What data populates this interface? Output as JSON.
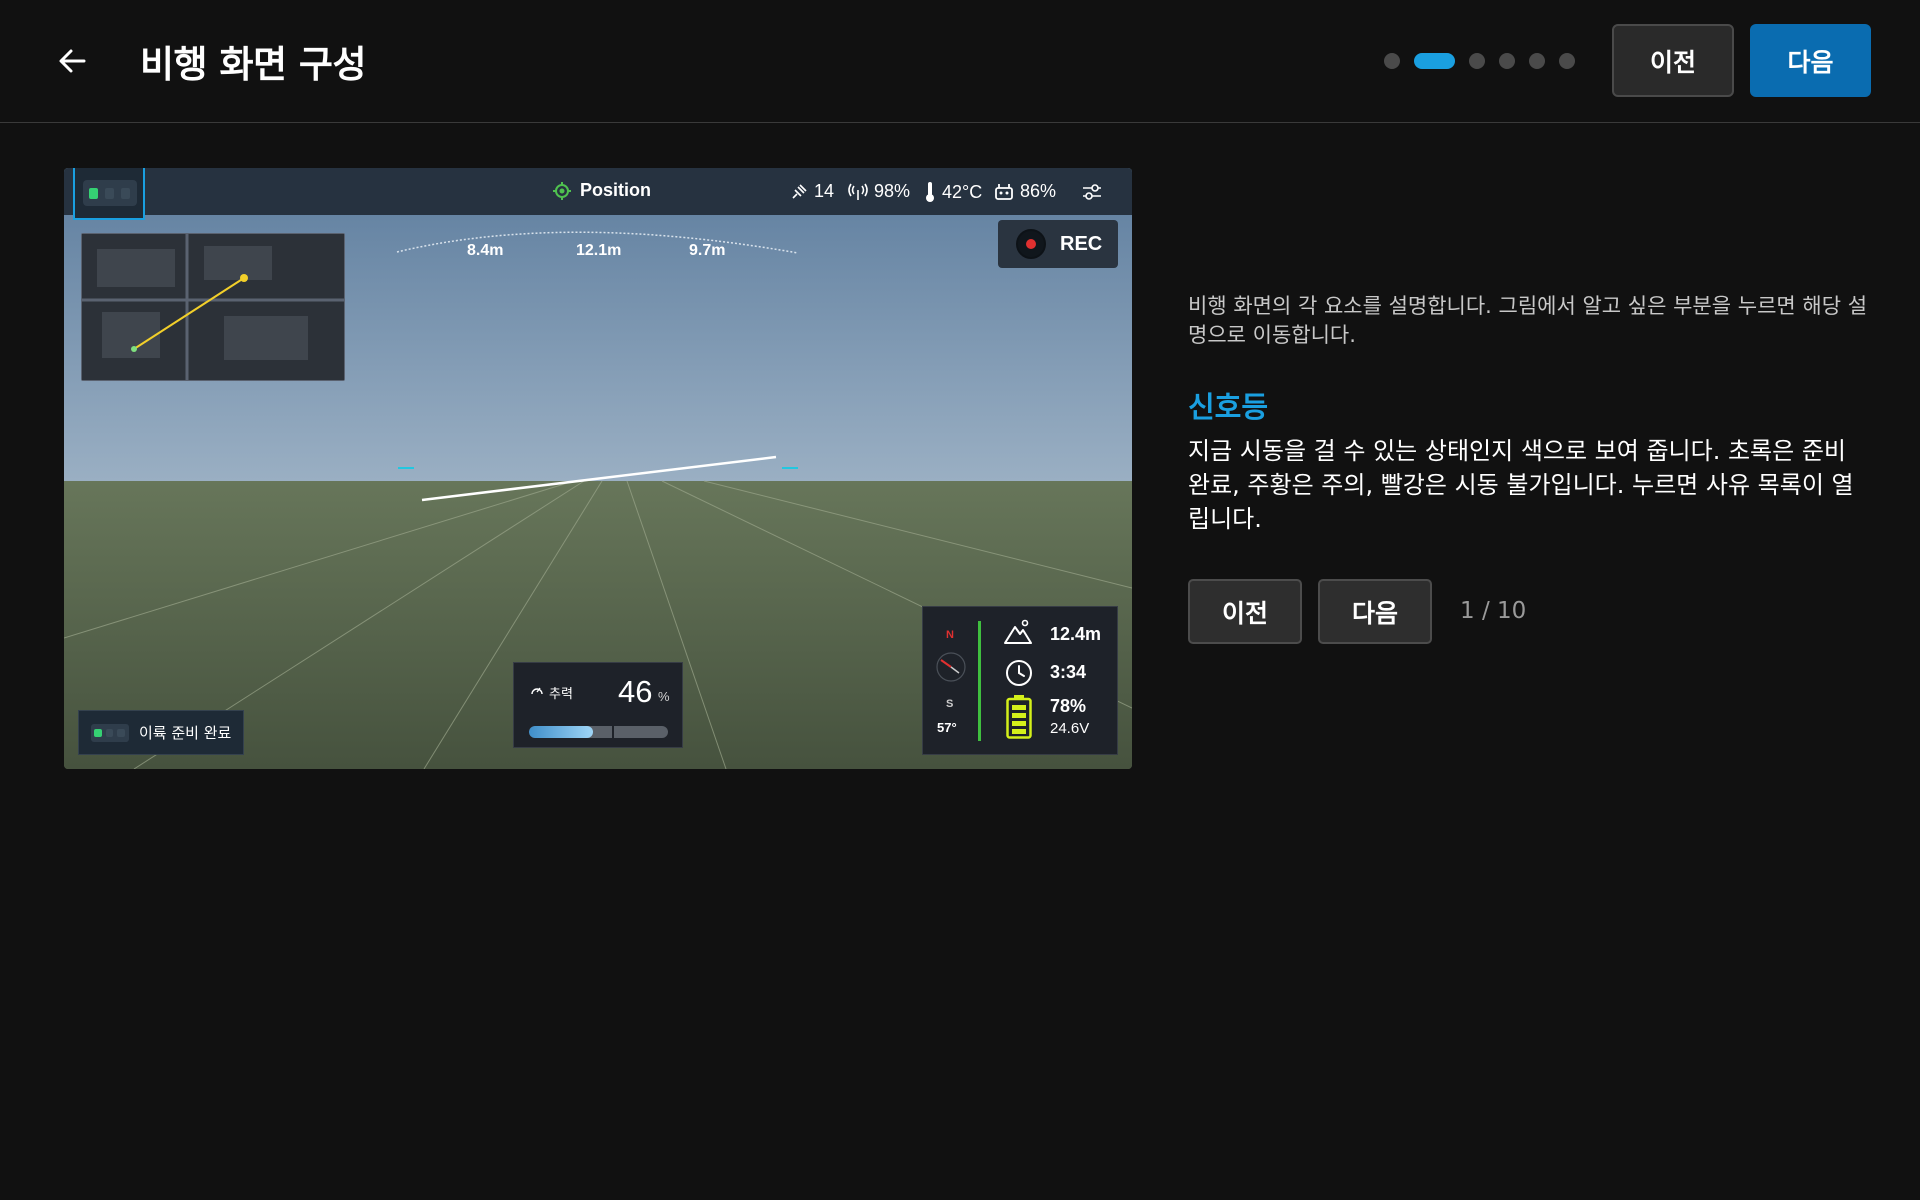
{
  "header": {
    "title": "비행 화면 구성",
    "prev_label": "이전",
    "next_label": "다음",
    "steps_total": 6,
    "steps_active_index": 1
  },
  "flight_view": {
    "flight_mode": "Position",
    "satellites": "14",
    "signal_strength": "98%",
    "temperature": "42°C",
    "controller_battery": "86%",
    "rec_label": "REC",
    "distances": [
      "8.4m",
      "12.1m",
      "9.7m"
    ],
    "takeoff_status": "이륙 준비 완료",
    "thrust": {
      "label": "추력",
      "value": "46",
      "unit": "%",
      "level_percent": 46
    },
    "telemetry": {
      "north": "N",
      "south": "S",
      "heading": "57°",
      "altitude": "12.4m",
      "flight_time": "3:34",
      "battery_percent": "78%",
      "battery_voltage": "24.6V"
    }
  },
  "panel": {
    "description": "비행 화면의 각 요소를 설명합니다. 그림에서 알고 싶은 부분을 누르면 해당 설명으로 이동합니다.",
    "section_title": "신호등",
    "section_body": "지금 시동을 걸 수 있는 상태인지 색으로 보여 줍니다. 초록은 준비 완료, 주황은 주의, 빨강은 시동 불가입니다. 누르면 사유 목록이 열립니다.",
    "prev_label": "이전",
    "next_label": "다음",
    "pager": "1 / 10"
  },
  "colors": {
    "accent": "#1a9fe0",
    "primary_button": "#0a6cb0",
    "ready_green": "#35d173",
    "rec_red": "#e03030"
  },
  "icons": {
    "back": "arrow-left-icon",
    "mode": "target-icon",
    "satellite": "satellite-icon",
    "signal": "antenna-icon",
    "temperature": "thermometer-icon",
    "controller": "controller-icon",
    "settings": "sliders-icon",
    "altitude": "mountain-icon",
    "time": "clock-icon",
    "battery": "battery-icon",
    "thrust": "gauge-icon"
  }
}
